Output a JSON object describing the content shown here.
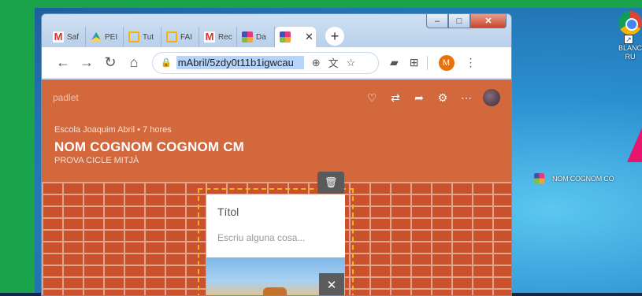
{
  "browser": {
    "tabs": [
      {
        "label": "Saf",
        "icon": "gmail-icon"
      },
      {
        "label": "PEI",
        "icon": "drive-icon"
      },
      {
        "label": "Tut",
        "icon": "slides-icon"
      },
      {
        "label": "FAI",
        "icon": "slides-icon"
      },
      {
        "label": "Rec",
        "icon": "gmail-icon"
      },
      {
        "label": "Da",
        "icon": "padlet-icon"
      },
      {
        "label": "",
        "icon": "padlet-icon",
        "active": true
      }
    ],
    "url": "mAbril/5zdy0t11b1igwcau",
    "avatar_letter": "M",
    "controls": {
      "minimize": "–",
      "maximize": "□",
      "close": "✕"
    }
  },
  "padlet": {
    "brand": "padlet",
    "author": "Escola Joaquim Abril",
    "time": "7 hores",
    "title": "NOM COGNOM COGNOM CM",
    "subtitle": "PROVA CICLE MITJÀ",
    "post": {
      "title_placeholder": "Títol",
      "body_placeholder": "Escriu alguna cosa..."
    }
  },
  "desktop": {
    "shortcut_label_line1": "BLANC",
    "shortcut_label_line2": "RU",
    "padlet_shortcut_label": "NOM COGNOM CO"
  },
  "colors": {
    "padlet_bg": "#d4683d",
    "frame": "#1aa34a",
    "url_highlight": "#b6d3f9"
  }
}
